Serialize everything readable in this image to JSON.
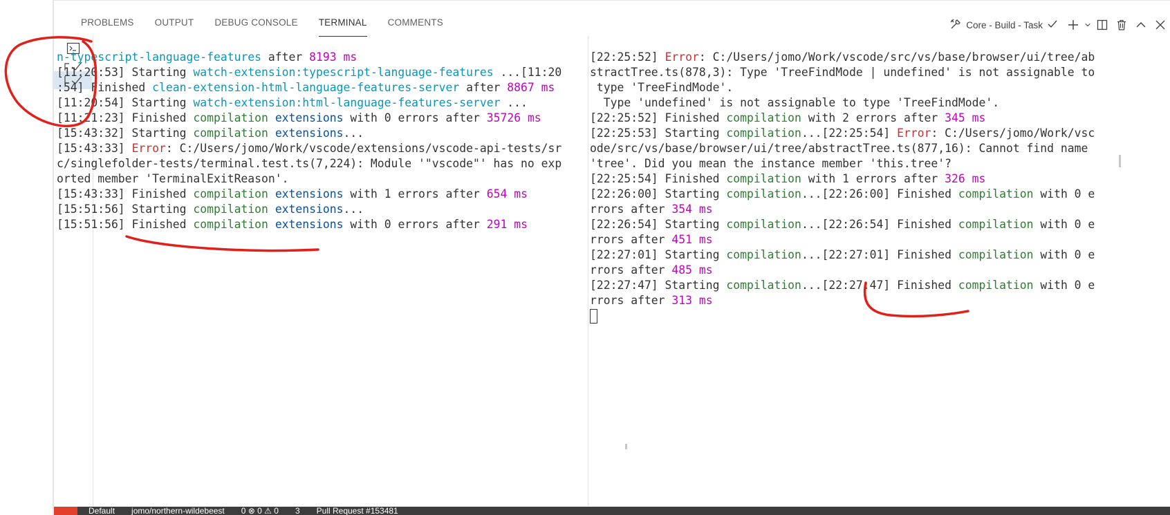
{
  "tabs": [
    {
      "label": "PROBLEMS"
    },
    {
      "label": "OUTPUT"
    },
    {
      "label": "DEBUG CONSOLE"
    },
    {
      "label": "TERMINAL"
    },
    {
      "label": "COMMENTS"
    }
  ],
  "toolbar": {
    "task_label": "Core - Build - Task",
    "icons": [
      "tools-icon",
      "check-icon",
      "plus-icon",
      "chevron-down-icon",
      "split-icon",
      "trash-icon",
      "chevron-up-icon",
      "close-icon"
    ]
  },
  "left_terminal": {
    "lines": [
      [
        {
          "t": "n-typescript-language-features",
          "c": "teal"
        },
        {
          "t": " after "
        },
        {
          "t": "8193 ms",
          "c": "mag"
        }
      ],
      [
        {
          "t": "[11:20:53] Starting "
        },
        {
          "t": "watch-extension:typescript-language-features",
          "c": "teal"
        },
        {
          "t": " ...[11:20"
        }
      ],
      [
        {
          "t": ":54] Finished "
        },
        {
          "t": "clean-extension-html-language-features-server",
          "c": "teal"
        },
        {
          "t": " after "
        },
        {
          "t": "8867 ms",
          "c": "mag"
        }
      ],
      [
        {
          "t": "[11:20:54] Starting "
        },
        {
          "t": "watch-extension:html-language-features-server",
          "c": "teal"
        },
        {
          "t": " ..."
        }
      ],
      [
        {
          "t": "[11:21:23] Finished "
        },
        {
          "t": "compilation",
          "c": "green"
        },
        {
          "t": " "
        },
        {
          "t": "extensions",
          "c": "blue"
        },
        {
          "t": " with 0 errors after "
        },
        {
          "t": "35726 ms",
          "c": "mag"
        }
      ],
      [
        {
          "t": "[15:43:32] Starting "
        },
        {
          "t": "compilation",
          "c": "green"
        },
        {
          "t": " "
        },
        {
          "t": "extensions",
          "c": "blue"
        },
        {
          "t": "..."
        }
      ],
      [
        {
          "t": "[15:43:33] "
        },
        {
          "t": "Error",
          "c": "error"
        },
        {
          "t": ": C:/Users/jomo/Work/vscode/extensions/vscode-api-tests/sr"
        }
      ],
      [
        {
          "t": "c/singlefolder-tests/terminal.test.ts(7,224): Module '\"vscode\"' has no exp"
        }
      ],
      [
        {
          "t": "orted member 'TerminalExitReason'."
        }
      ],
      [
        {
          "t": "[15:43:33] Finished "
        },
        {
          "t": "compilation",
          "c": "green"
        },
        {
          "t": " "
        },
        {
          "t": "extensions",
          "c": "blue"
        },
        {
          "t": " with 1 errors after "
        },
        {
          "t": "654 ms",
          "c": "mag"
        }
      ],
      [
        {
          "t": "[15:51:56] Starting "
        },
        {
          "t": "compilation",
          "c": "green"
        },
        {
          "t": " "
        },
        {
          "t": "extensions",
          "c": "blue"
        },
        {
          "t": "..."
        }
      ],
      [
        {
          "t": "[15:51:56] Finished "
        },
        {
          "t": "compilation",
          "c": "green"
        },
        {
          "t": " "
        },
        {
          "t": "extensions",
          "c": "blue"
        },
        {
          "t": " with 0 errors after "
        },
        {
          "t": "291 ms",
          "c": "mag"
        }
      ]
    ]
  },
  "right_terminal": {
    "lines": [
      [
        {
          "t": "[22:25:52] "
        },
        {
          "t": "Error",
          "c": "error"
        },
        {
          "t": ": C:/Users/jomo/Work/vscode/src/vs/base/browser/ui/tree/ab"
        }
      ],
      [
        {
          "t": "stractTree.ts(878,3): Type 'TreeFindMode | undefined' is not assignable to"
        }
      ],
      [
        {
          "t": " type 'TreeFindMode'."
        }
      ],
      [
        {
          "t": "  Type 'undefined' is not assignable to type 'TreeFindMode'."
        }
      ],
      [
        {
          "t": "[22:25:52] Finished "
        },
        {
          "t": "compilation",
          "c": "green"
        },
        {
          "t": " with 2 errors after "
        },
        {
          "t": "345 ms",
          "c": "mag"
        }
      ],
      [
        {
          "t": "[22:25:53] Starting "
        },
        {
          "t": "compilation",
          "c": "green"
        },
        {
          "t": "...[22:25:54] "
        },
        {
          "t": "Error",
          "c": "error"
        },
        {
          "t": ": C:/Users/jomo/Work/vsc"
        }
      ],
      [
        {
          "t": "ode/src/vs/base/browser/ui/tree/abstractTree.ts(877,16): Cannot find name"
        }
      ],
      [
        {
          "t": "'tree'. Did you mean the instance member 'this.tree'?"
        }
      ],
      [
        {
          "t": "[22:25:54] Finished "
        },
        {
          "t": "compilation",
          "c": "green"
        },
        {
          "t": " with 1 errors after "
        },
        {
          "t": "326 ms",
          "c": "mag"
        }
      ],
      [
        {
          "t": "[22:26:00] Starting "
        },
        {
          "t": "compilation",
          "c": "green"
        },
        {
          "t": "...[22:26:00] Finished "
        },
        {
          "t": "compilation",
          "c": "green"
        },
        {
          "t": " with 0 e"
        }
      ],
      [
        {
          "t": "rrors after "
        },
        {
          "t": "354 ms",
          "c": "mag"
        }
      ],
      [
        {
          "t": "[22:26:54] Starting "
        },
        {
          "t": "compilation",
          "c": "green"
        },
        {
          "t": "...[22:26:54] Finished "
        },
        {
          "t": "compilation",
          "c": "green"
        },
        {
          "t": " with 0 e"
        }
      ],
      [
        {
          "t": "rrors after "
        },
        {
          "t": "451 ms",
          "c": "mag"
        }
      ],
      [
        {
          "t": "[22:27:01] Starting "
        },
        {
          "t": "compilation",
          "c": "green"
        },
        {
          "t": "...[22:27:01] Finished "
        },
        {
          "t": "compilation",
          "c": "green"
        },
        {
          "t": " with 0 e"
        }
      ],
      [
        {
          "t": "rrors after "
        },
        {
          "t": "485 ms",
          "c": "mag"
        }
      ],
      [
        {
          "t": "[22:27:47] Starting "
        },
        {
          "t": "compilation",
          "c": "green"
        },
        {
          "t": "...[22:27:47] Finished "
        },
        {
          "t": "compilation",
          "c": "green"
        },
        {
          "t": " with 0 e"
        }
      ],
      [
        {
          "t": "rrors after "
        },
        {
          "t": "313 ms",
          "c": "mag"
        }
      ]
    ]
  },
  "status_bar": {
    "items": [
      "Default",
      "jomo/northern-wildebeest",
      "0 ⊗ 0 ⚠ 0",
      "3",
      "Pull Request #153481"
    ]
  },
  "colors": {
    "annotation": "#e0201a",
    "error": "#cd3131",
    "green": "#2e7d32",
    "blue": "#0451a5",
    "teal": "#0598bc",
    "magenta": "#bc05bc"
  }
}
